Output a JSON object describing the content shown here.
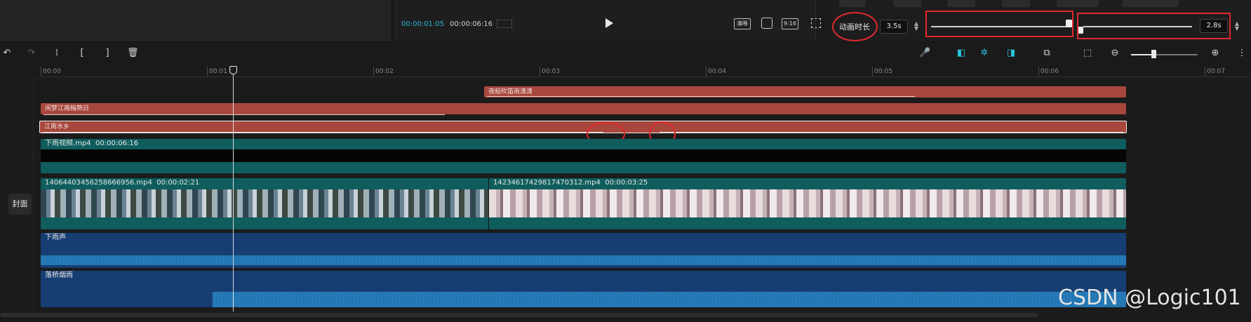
{
  "player": {
    "current_time": "00:00:01:05",
    "total_time": "00:00:06:16",
    "buttons": [
      "清晰",
      "9:16"
    ]
  },
  "animation": {
    "duration_label": "动画时长",
    "in_duration": "3.5s",
    "out_duration": "2.8s",
    "in_slider_value": 1.0,
    "out_slider_value": 0.0
  },
  "ruler": {
    "ticks": [
      "00:00",
      "00:01",
      "00:02",
      "00:03",
      "00:04",
      "00:05",
      "00:06",
      "00:07"
    ]
  },
  "timeline": {
    "cover_label": "封面",
    "text_tracks": [
      {
        "label": "夜船吹笛雨潇潇"
      },
      {
        "label": "闲梦江南梅熟日"
      },
      {
        "label": "江南水乡"
      }
    ],
    "video_clips": [
      {
        "name": "下雨视频.mp4",
        "duration": "00:00:06:16"
      },
      {
        "name": "14064403456258666956.mp4",
        "duration": "00:00:02:21"
      },
      {
        "name": "14234617429817470312.mp4",
        "duration": "00:00:03:25"
      }
    ],
    "audio_clips": [
      {
        "name": "下雨声"
      },
      {
        "name": "落桥烟雨"
      }
    ]
  },
  "colors": {
    "accent": "#28c3dd",
    "text_clip": "#a8473d",
    "video_clip": "#0f5d5d",
    "audio_clip": "#163e73",
    "highlight": "#e0292e"
  },
  "watermark": "CSDN @Logic101"
}
